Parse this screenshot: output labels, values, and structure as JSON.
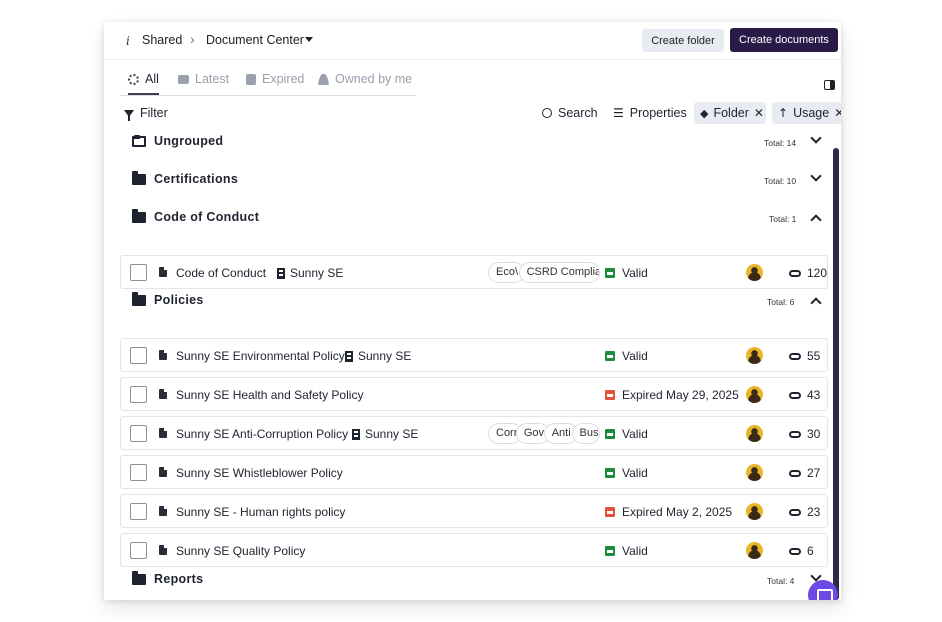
{
  "header": {
    "breadcrumb": [
      "Shared",
      "Document Center"
    ],
    "create_folder_label": "Create folder",
    "create_documents_label": "Create documents"
  },
  "tabs": [
    {
      "label": "All",
      "icon": "grid-icon",
      "active": true
    },
    {
      "label": "Latest",
      "icon": "layers-icon",
      "active": false
    },
    {
      "label": "Expired",
      "icon": "calendar-x-icon",
      "active": false
    },
    {
      "label": "Owned by me",
      "icon": "user-icon",
      "active": false
    }
  ],
  "toolbar": {
    "filter_label": "Filter",
    "search_label": "Search",
    "properties_label": "Properties",
    "chips": [
      {
        "label": "Folder",
        "icon": "stack-icon"
      },
      {
        "label": "Usage",
        "icon": "arrow-up-icon"
      }
    ]
  },
  "groups": [
    {
      "name": "Ungrouped",
      "total": "Total: 14",
      "expanded": false
    },
    {
      "name": "Certifications",
      "total": "Total: 10",
      "expanded": false
    },
    {
      "name": "Code of Conduct",
      "total": "Total: 1",
      "expanded": true
    },
    {
      "name": "Policies",
      "total": "Total: 6",
      "expanded": true
    },
    {
      "name": "Reports",
      "total": "Total: 4",
      "expanded": false
    }
  ],
  "rows": [
    {
      "name": "Code of Conduct",
      "org": "Sunny SE",
      "tags": [
        "Eco\\",
        "CSRD Complian"
      ],
      "status": "Valid",
      "status_color": "#1e8a3c",
      "usage": "120"
    },
    {
      "name": "Sunny SE Environmental Policy",
      "org": "Sunny SE",
      "tags": [],
      "status": "Valid",
      "status_color": "#1e8a3c",
      "usage": "55"
    },
    {
      "name": "Sunny SE Health and Safety Policy",
      "org": "",
      "tags": [],
      "status": "Expired May 29, 2025",
      "status_color": "#e0533a",
      "usage": "43"
    },
    {
      "name": "Sunny SE Anti-Corruption Policy",
      "org": "Sunny SE",
      "tags": [
        "Corr",
        "Gove",
        "Anti",
        "Bus"
      ],
      "status": "Valid",
      "status_color": "#1e8a3c",
      "usage": "30"
    },
    {
      "name": "Sunny SE Whistleblower Policy",
      "org": "",
      "tags": [],
      "status": "Valid",
      "status_color": "#1e8a3c",
      "usage": "27"
    },
    {
      "name": "Sunny SE - Human rights policy",
      "org": "",
      "tags": [],
      "status": "Expired May 2, 2025",
      "status_color": "#e0533a",
      "usage": "23"
    },
    {
      "name": "Sunny SE Quality Policy",
      "org": "",
      "tags": [],
      "status": "Valid",
      "status_color": "#1e8a3c",
      "usage": "6"
    }
  ],
  "colors": {
    "primary": "#2a1a47",
    "valid": "#1e8a3c",
    "expired": "#e0533a",
    "chat": "#6d4ae6"
  }
}
